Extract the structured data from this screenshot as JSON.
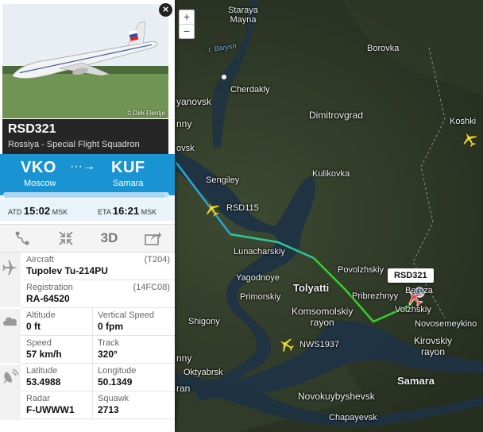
{
  "map": {
    "labels": {
      "staraya_mayna": "Staraya\nMayna",
      "borovka": "Borovka",
      "cherdakly": "Cherdakly",
      "yanovsk": "yanovsk",
      "dimitrovgrad": "Dimitrovgrad",
      "koshki": "Koshki",
      "nny1": "nny",
      "ovsk": "ovsk",
      "sengiley": "Sengiley",
      "kulikovka": "Kulikovka",
      "lunacharskiy": "Lunacharskiy",
      "povolzhskiy": "Povolzhskiy",
      "yagodnoye": "Yagodnoye",
      "tolyatti": "Tolyatti",
      "primorskiy": "Primorskiy",
      "pribrezhnyy": "Pribrezhnyy",
      "berezovka": "Bereza",
      "volzhskiy": "Volzhskiy",
      "komsomolskiy": "Komsomolskiy\nrayon",
      "novosemeykino": "Novosemeykino",
      "shigony": "Shigony",
      "kirovskiy": "Kirovskiy\nrayon",
      "oktyabrsk": "Oktyabrsk",
      "samara": "Samara",
      "novokuybyshevsk": "Novokuybyshevsk",
      "chapayevsk": "Chapayevsk",
      "nny2": "nny",
      "ran": "ran",
      "river": "r. Barysh"
    },
    "planes": [
      "RSD115",
      "NWS1937"
    ],
    "selected_callout": "RSD321",
    "zoom_in": "+",
    "zoom_out": "−"
  },
  "panel": {
    "photo_credit": "© Dirk Flentje",
    "close": "×",
    "callsign": "RSD321",
    "airline": "Rossiya - Special Flight Squadron",
    "origin": {
      "code": "VKO",
      "city": "Moscow"
    },
    "destination": {
      "code": "KUF",
      "city": "Samara"
    },
    "route_arrow": "···→",
    "progress_fraction": 0.97,
    "atd_label": "ATD",
    "atd_time": "15:02",
    "atd_tz": "MSK",
    "eta_label": "ETA",
    "eta_time": "16:21",
    "eta_tz": "MSK",
    "tools": {
      "route": "route-icon",
      "expand": "expand-icon",
      "view3d": "3D",
      "share": "share-icon"
    },
    "aircraft": {
      "label": "Aircraft",
      "value": "Tupolev Tu-214PU",
      "code": "(T204)"
    },
    "registration": {
      "label": "Registration",
      "value": "RA-64520",
      "code": "(14FC08)"
    },
    "altitude": {
      "label": "Altitude",
      "value": "0 ft"
    },
    "vspeed": {
      "label": "Vertical Speed",
      "value": "0 fpm"
    },
    "speed": {
      "label": "Speed",
      "value": "57 km/h"
    },
    "track": {
      "label": "Track",
      "value": "320°"
    },
    "latitude": {
      "label": "Latitude",
      "value": "53.4988"
    },
    "longitude": {
      "label": "Longitude",
      "value": "50.1349"
    },
    "radar": {
      "label": "Radar",
      "value": "F-UWWW1"
    },
    "squawk": {
      "label": "Squawk",
      "value": "2713"
    }
  },
  "colors": {
    "route_blue": "#1a93d2",
    "path_cyan": "#2aa6d6",
    "path_green": "#33d12a"
  }
}
